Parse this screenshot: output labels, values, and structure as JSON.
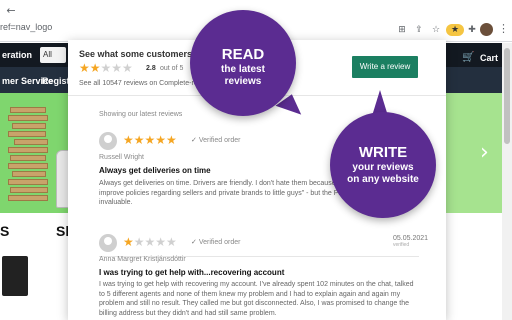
{
  "browser": {
    "url_fragment": "ref=nav_logo",
    "back_glyph": "←",
    "forward_glyph": "→",
    "kebab_glyph": "⋮"
  },
  "store": {
    "nav_left": "eration",
    "select_label": "All",
    "sub_left": "mer Service",
    "sub_next": "Registry",
    "cart_label": "Cart",
    "card_title_1": "Sh",
    "card_title_2": "S",
    "next_arrow": "›"
  },
  "popup": {
    "title": "See what some customers are",
    "overall_stars": 2,
    "rating_value": "2.8",
    "rating_suffix": "out of 5",
    "see_all": "See all 10547 reviews on Complete-revi",
    "write_button": "Write a review",
    "showing_label": "Showing our latest reviews",
    "verified_label": "Verified order",
    "reviews": [
      {
        "stars": 5,
        "name": "Russell Wright",
        "title": "Always get deliveries on time",
        "body": "Always get deliveries on time. Drivers are friendly. I don't hate them because suggest that they improve policies regarding sellers and private brands to little guys\" - but the Prime service is invaluable."
      },
      {
        "stars": 1,
        "name": "Anna Margret Kristjánsdóttir",
        "date": "05.05.2021",
        "date_sub": "verified",
        "title": "I was trying to get help with...recovering account",
        "body": "I was trying to get help with recovering my account. I've already spent 102 minutes on the chat, talked to 5 different agents and none of them knew my problem and I had to explain again and again my problem and still no result. They called me but got disconnected. Also, I was promised to change the billing address but they didn't and had still same problem."
      }
    ]
  },
  "bubbles": {
    "read_head": "READ",
    "read_line1": "the latest",
    "read_line2": "reviews",
    "write_head": "WRITE",
    "write_line1": "your reviews",
    "write_line2": "on any website"
  },
  "colors": {
    "accent_purple": "#5b2c91",
    "button_green": "#1b7f61",
    "star_gold": "#f5a623",
    "hero_green": "#7fd66e"
  }
}
